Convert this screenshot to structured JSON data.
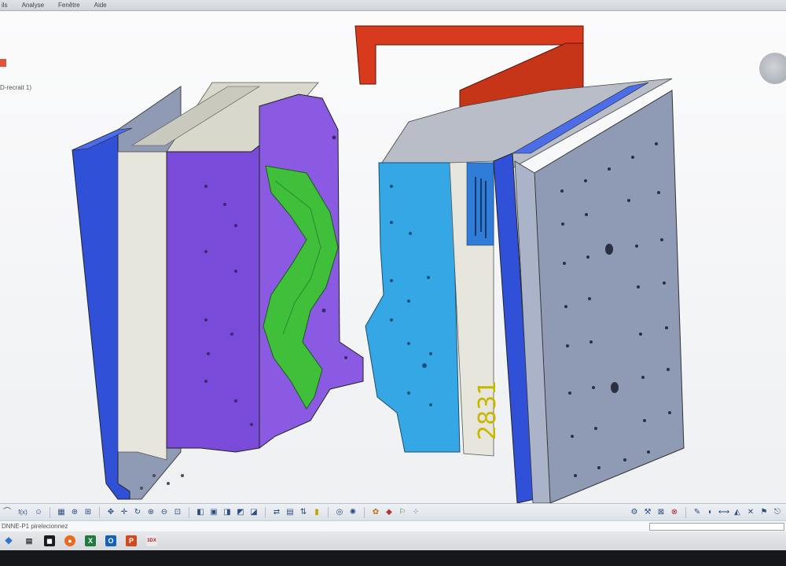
{
  "menu": {
    "items": [
      "ils",
      "Analyse",
      "Fenêtre",
      "Aide"
    ]
  },
  "tree": {
    "node_label": "D-recrait 1)"
  },
  "model": {
    "part_number": "2831",
    "colors": {
      "blue_plate": "#3050d8",
      "purple_core": "#7a4ad8",
      "green_part": "#3fbf3a",
      "light_blue_insert": "#35a7e4",
      "red_handle": "#d83a1e",
      "grey_plate": "#8f9ab5",
      "cream_plate": "#e6e6dc"
    }
  },
  "toolbar": {
    "fx_label": "f(x)",
    "icons": [
      "drafting-icon",
      "grid-icon",
      "measure-icon",
      "axis-icon",
      "move-icon",
      "pan-icon",
      "rotate-icon",
      "zoom-in-icon",
      "zoom-out-icon",
      "fit-all-icon",
      "view-iso-icon",
      "view-front-icon",
      "view-top-icon",
      "render-icon",
      "shading-icon",
      "wireframe-icon",
      "hide-show-icon",
      "lock-icon",
      "spin-icon",
      "compass-icon",
      "catalog-icon",
      "material-icon",
      "snap-icon"
    ],
    "right_icons": [
      "part-icon",
      "assembly-icon",
      "select-icon",
      "close-view-icon",
      "analysis-icon",
      "section-icon",
      "measure-between-icon",
      "inertia-icon",
      "clash-icon",
      "tools-icon",
      "exit-icon"
    ]
  },
  "status": {
    "text": "DNNE-P1 pirelecionnez"
  },
  "taskbar": {
    "icons": [
      "start-icon",
      "taskview-icon",
      "browser-icon",
      "excel-icon",
      "outlook-icon",
      "powerpoint-icon",
      "catia-icon"
    ],
    "catia_label": "3DX"
  }
}
